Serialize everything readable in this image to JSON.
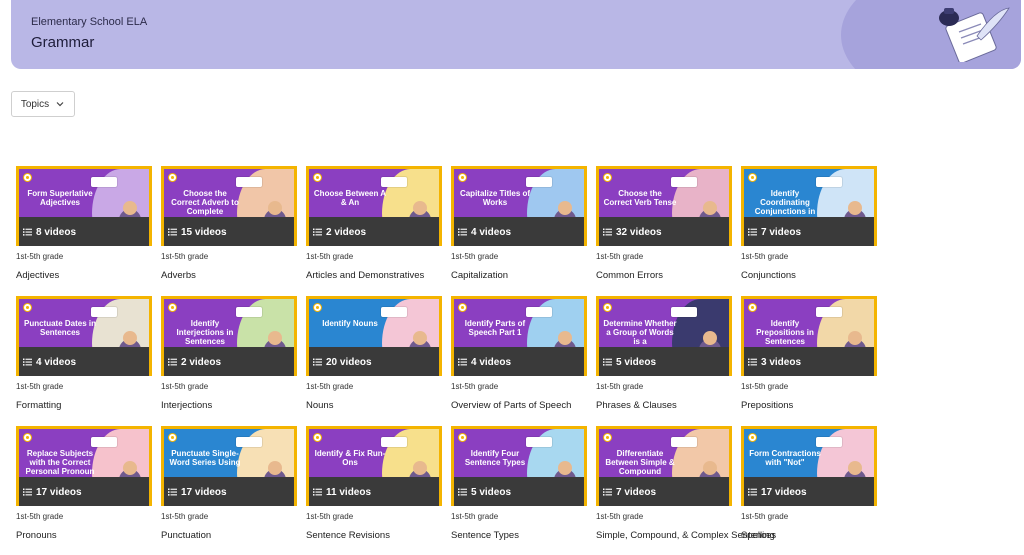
{
  "header": {
    "subject": "Elementary School ELA",
    "title": "Grammar",
    "icon": "inkwell-paper-icon"
  },
  "filter": {
    "label": "Topics",
    "icon": "chevron-down-icon"
  },
  "colors": {
    "header_bg": "#b9b7e6",
    "card_border": "#f4b400",
    "video_bar": "#3a3a3a"
  },
  "cards": [
    {
      "thumb_text": "Form Superlative Adjectives",
      "videos": "8 videos",
      "grade": "1st-5th grade",
      "topic": "Adjectives",
      "bg": "#8b3fc1",
      "accent": "#c9a8e6"
    },
    {
      "thumb_text": "Choose the Correct Adverb to Complete",
      "videos": "15 videos",
      "grade": "1st-5th grade",
      "topic": "Adverbs",
      "bg": "#8b3fc1",
      "accent": "#f1c6a8"
    },
    {
      "thumb_text": "Choose Between A & An",
      "videos": "2 videos",
      "grade": "1st-5th grade",
      "topic": "Articles and Demonstratives",
      "bg": "#8b3fc1",
      "accent": "#f7e08c"
    },
    {
      "thumb_text": "Capitalize Titles of Works",
      "videos": "4 videos",
      "grade": "1st-5th grade",
      "topic": "Capitalization",
      "bg": "#8b3fc1",
      "accent": "#9fc8f0"
    },
    {
      "thumb_text": "Choose the Correct Verb Tense",
      "videos": "32 videos",
      "grade": "1st-5th grade",
      "topic": "Common Errors",
      "bg": "#8b3fc1",
      "accent": "#e8b3c8"
    },
    {
      "thumb_text": "Identify Coordinating Conjunctions in",
      "videos": "7 videos",
      "grade": "1st-5th grade",
      "topic": "Conjunctions",
      "bg": "#2a86d1",
      "accent": "#cfe4f7"
    },
    {
      "thumb_text": "Punctuate Dates in Sentences",
      "videos": "4 videos",
      "grade": "1st-5th grade",
      "topic": "Formatting",
      "bg": "#8b3fc1",
      "accent": "#e8e2d2"
    },
    {
      "thumb_text": "Identify Interjections in Sentences",
      "videos": "2 videos",
      "grade": "1st-5th grade",
      "topic": "Interjections",
      "bg": "#8b3fc1",
      "accent": "#c9e2a8"
    },
    {
      "thumb_text": "Identify Nouns",
      "videos": "20 videos",
      "grade": "1st-5th grade",
      "topic": "Nouns",
      "bg": "#2a86d1",
      "accent": "#f4c6d6"
    },
    {
      "thumb_text": "Identify Parts of Speech Part 1",
      "videos": "4 videos",
      "grade": "1st-5th grade",
      "topic": "Overview of Parts of Speech",
      "bg": "#8b3fc1",
      "accent": "#9fd0f0"
    },
    {
      "thumb_text": "Determine Whether a Group of Words is a",
      "videos": "5 videos",
      "grade": "1st-5th grade",
      "topic": "Phrases & Clauses",
      "bg": "#8b3fc1",
      "accent": "#3a3a6e"
    },
    {
      "thumb_text": "Identify Prepositions in Sentences",
      "videos": "3 videos",
      "grade": "1st-5th grade",
      "topic": "Prepositions",
      "bg": "#8b3fc1",
      "accent": "#f2d8a8"
    },
    {
      "thumb_text": "Replace Subjects with the Correct Personal Pronoun",
      "videos": "17 videos",
      "grade": "1st-5th grade",
      "topic": "Pronouns",
      "bg": "#8b3fc1",
      "accent": "#f6c2cc"
    },
    {
      "thumb_text": "Punctuate Single-Word Series Using",
      "videos": "17 videos",
      "grade": "1st-5th grade",
      "topic": "Punctuation",
      "bg": "#2a86d1",
      "accent": "#f7e0b5"
    },
    {
      "thumb_text": "Identify & Fix Run-Ons",
      "videos": "11 videos",
      "grade": "1st-5th grade",
      "topic": "Sentence Revisions",
      "bg": "#8b3fc1",
      "accent": "#f7e08c"
    },
    {
      "thumb_text": "Identify Four Sentence Types",
      "videos": "5 videos",
      "grade": "1st-5th grade",
      "topic": "Sentence Types",
      "bg": "#8b3fc1",
      "accent": "#a8d8f0"
    },
    {
      "thumb_text": "Differentiate Between Simple & Compound Sentences",
      "videos": "7 videos",
      "grade": "1st-5th grade",
      "topic": "Simple, Compound, & Complex Sentences",
      "bg": "#8b3fc1",
      "accent": "#f2c8a8"
    },
    {
      "thumb_text": "Form Contractions with \"Not\"",
      "videos": "17 videos",
      "grade": "1st-5th grade",
      "topic": "Spelling",
      "bg": "#2a86d1",
      "accent": "#f4c6d6"
    }
  ]
}
